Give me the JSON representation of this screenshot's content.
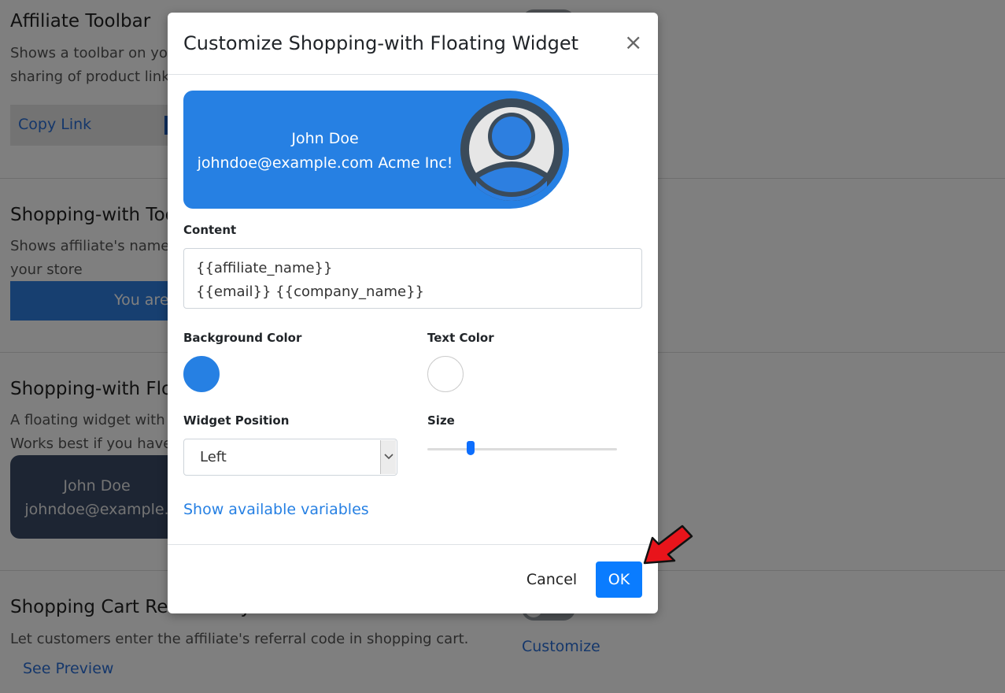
{
  "background": {
    "affiliate_toolbar": {
      "title": "Affiliate Toolbar",
      "desc_line1": "Shows a toolbar on you",
      "desc_line2": "sharing of product link",
      "copy_link": "Copy Link"
    },
    "shopping_with_toolbar": {
      "title": "Shopping-with Too",
      "desc_line1": "Shows affiliate's name",
      "desc_line2": "your store",
      "bar_text": "You are"
    },
    "shopping_with_floating": {
      "title": "Shopping-with Flo",
      "desc_line1": "A floating widget with",
      "desc_line2": "Works best if you have",
      "widget_name": "John Doe",
      "widget_email": "johndoe@example."
    },
    "shopping_cart": {
      "title": "Shopping Cart Referred By",
      "desc": "Let customers enter the affiliate's referral code in shopping cart.",
      "see_preview": "See Preview",
      "customize": "Customize"
    }
  },
  "modal": {
    "title": "Customize Shopping-with Floating Widget",
    "close": "×",
    "preview": {
      "name": "John Doe",
      "details": "johndoe@example.com Acme Inc!"
    },
    "content_label": "Content",
    "content_value": "{{affiliate_name}}\n{{email}} {{company_name}}",
    "bg_color_label": "Background Color",
    "bg_color": "#2680e3",
    "text_color_label": "Text Color",
    "text_color": "#ffffff",
    "position_label": "Widget Position",
    "position_value": "Left",
    "size_label": "Size",
    "size_fraction": 0.23,
    "show_vars": "Show available variables",
    "cancel": "Cancel",
    "ok": "OK"
  },
  "colors": {
    "accent": "#0a7cff",
    "annotation_arrow": "#e8141b"
  }
}
